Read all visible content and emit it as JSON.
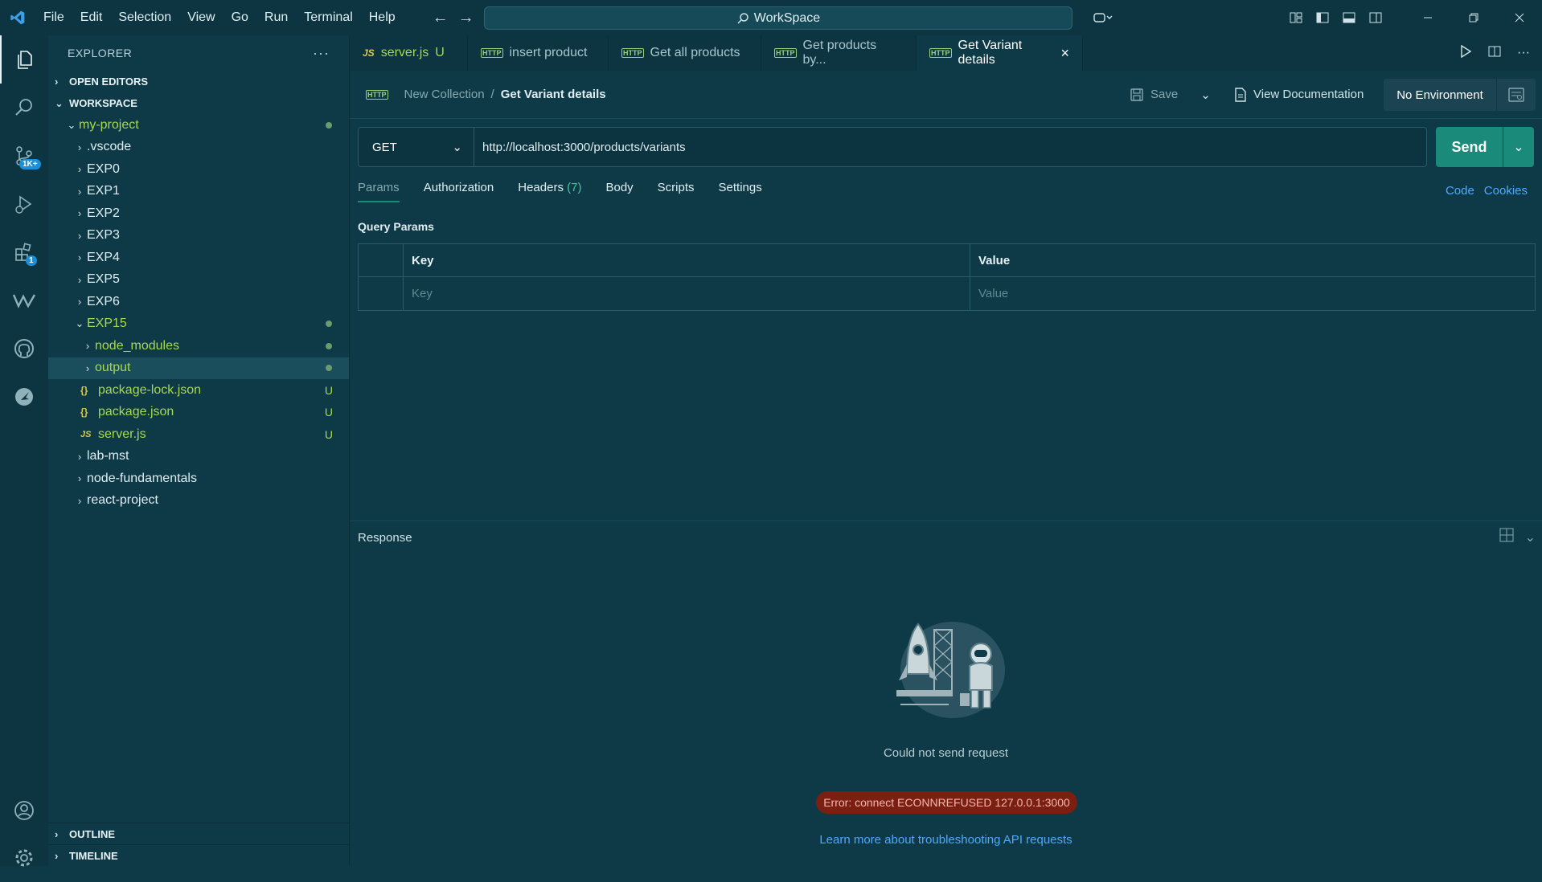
{
  "menu": [
    "File",
    "Edit",
    "Selection",
    "View",
    "Go",
    "Run",
    "Terminal",
    "Help"
  ],
  "search": {
    "label": "WorkSpace"
  },
  "activity": {
    "scm_badge": "1K+",
    "ext_badge": "1"
  },
  "explorer": {
    "title": "EXPLORER",
    "open_editors": "OPEN EDITORS",
    "workspace": "WORKSPACE",
    "outline": "OUTLINE",
    "timeline": "TIMELINE",
    "tree": [
      {
        "label": "my-project",
        "git": true,
        "dot": true
      },
      {
        "label": ".vscode"
      },
      {
        "label": "EXP0"
      },
      {
        "label": "EXP1"
      },
      {
        "label": "EXP2"
      },
      {
        "label": "EXP3"
      },
      {
        "label": "EXP4"
      },
      {
        "label": "EXP5"
      },
      {
        "label": "EXP6"
      },
      {
        "label": "EXP15",
        "git": true,
        "dot": true
      },
      {
        "label": "node_modules",
        "git": true,
        "dot": true
      },
      {
        "label": "output",
        "git": true,
        "dot": true
      },
      {
        "label": "package-lock.json",
        "status": "U"
      },
      {
        "label": "package.json",
        "status": "U"
      },
      {
        "label": "server.js",
        "status": "U"
      },
      {
        "label": "lab-mst"
      },
      {
        "label": "node-fundamentals"
      },
      {
        "label": "react-project"
      }
    ]
  },
  "tabs": [
    {
      "label": "server.js",
      "status": "U"
    },
    {
      "label": "insert product"
    },
    {
      "label": "Get all products"
    },
    {
      "label": "Get products by..."
    },
    {
      "label": "Get Variant details"
    }
  ],
  "request": {
    "collection": "New Collection",
    "separator": "/",
    "name": "Get Variant details",
    "save": "Save",
    "view_doc": "View Documentation",
    "environment": "No Environment",
    "method": "GET",
    "url": "http://localhost:3000/products/variants",
    "send": "Send",
    "subtabs": {
      "params": "Params",
      "authorization": "Authorization",
      "headers": "Headers",
      "headers_count": "(7)",
      "body": "Body",
      "scripts": "Scripts",
      "settings": "Settings"
    },
    "code": "Code",
    "cookies": "Cookies",
    "query_title": "Query Params",
    "col_key": "Key",
    "col_value": "Value",
    "ph_key": "Key",
    "ph_value": "Value"
  },
  "response": {
    "title": "Response",
    "message": "Could not send request",
    "error": "Error: connect ECONNREFUSED 127.0.0.1:3000",
    "link": "Learn more about troubleshooting API requests"
  },
  "colors": {
    "accent": "#1a8a7b",
    "bg": "#0e3a47",
    "error_bg": "#7a1f12",
    "link": "#4fa8ff",
    "git": "#a7d94e"
  }
}
